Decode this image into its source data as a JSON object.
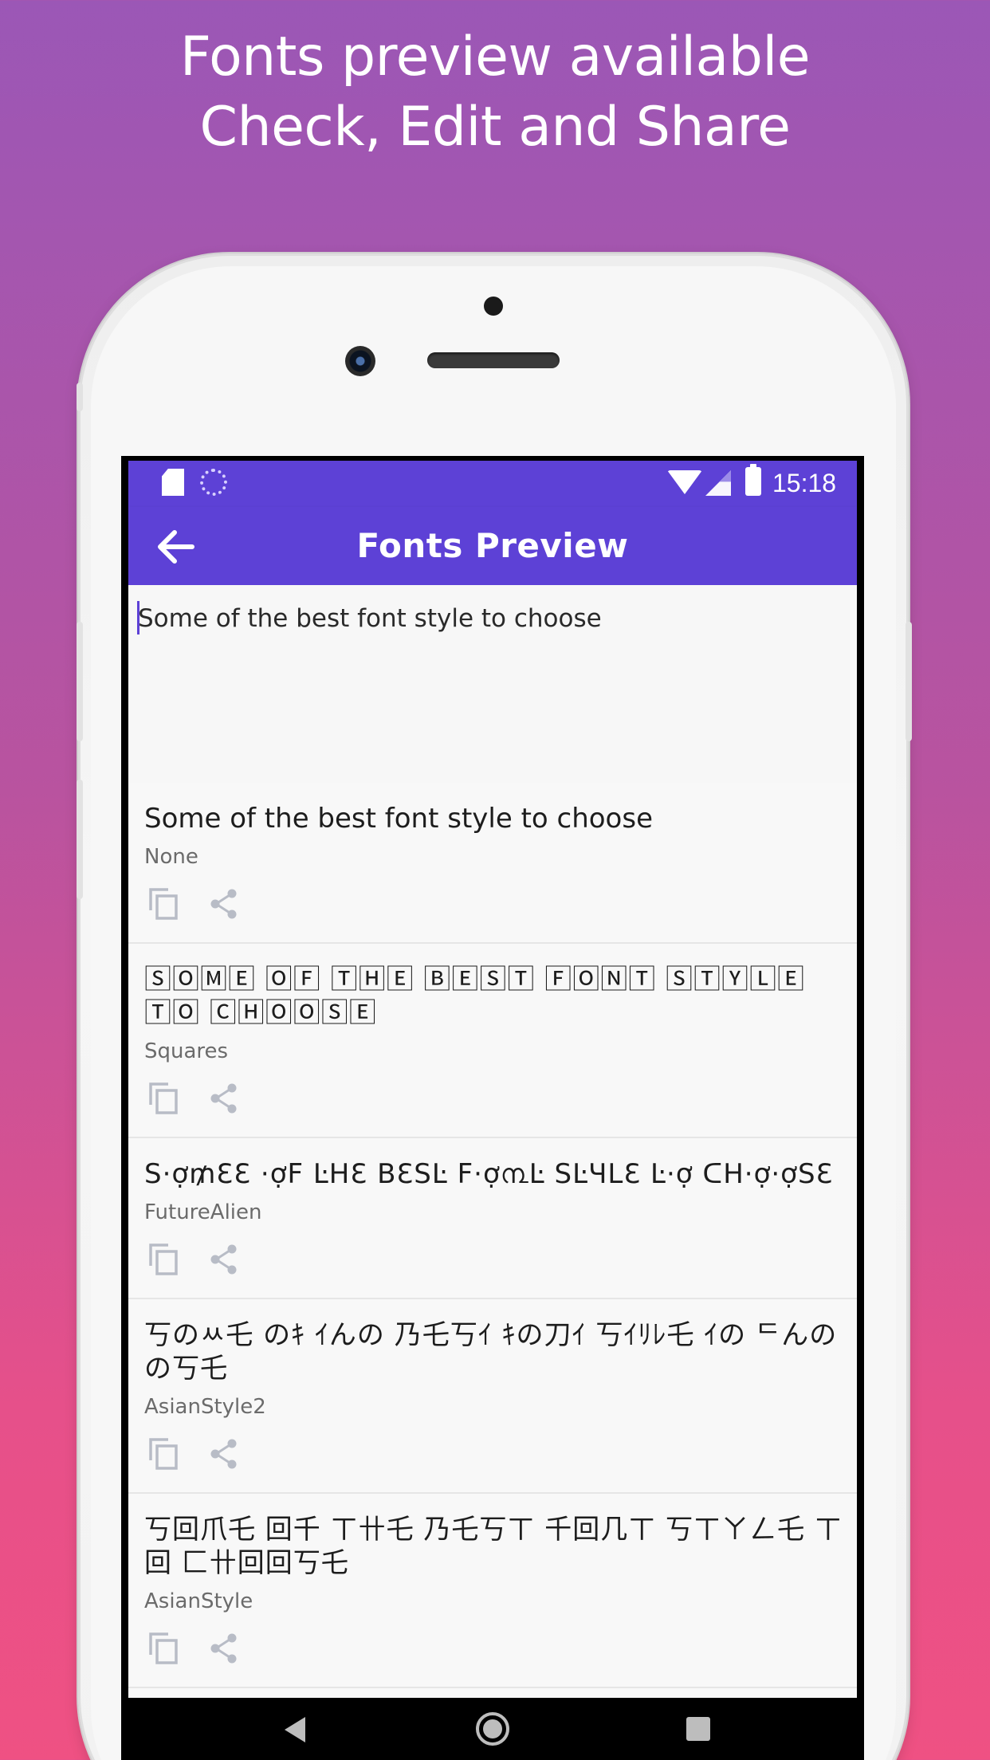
{
  "headline": {
    "line1": "Fonts preview available",
    "line2": "Check, Edit and Share"
  },
  "statusbar": {
    "time": "15:18",
    "icons": [
      "sd-card-icon",
      "sync-icon",
      "wifi-icon",
      "signal-icon",
      "battery-charging-icon"
    ]
  },
  "appbar": {
    "title": "Fonts Preview",
    "back_icon": "arrow-left-icon"
  },
  "editor": {
    "value": "Some of the best font style to choose"
  },
  "fonts": [
    {
      "text": "Some of the best font style to choose",
      "name": "None"
    },
    {
      "text": "🅂🄾🄼🄴 🄾🄵 🅃🄷🄴 🄱🄴🅂🅃 🄵🄾🄽🅃 🅂🅃🅈🄻🄴 🅃🄾 🄲🄷🄾🄾🅂🄴",
      "name": "Squares"
    },
    {
      "text": "S·ợ₥ƐƐ ·ợF ĿHƐ BƐSĿ F·ợ൩Ŀ SĿЧLƐ Ŀ·ợ ᑕH·ợ·ợSƐ",
      "name": "FutureAlien"
    },
    {
      "text": "丂のﾶ乇 のｷ ｲんの 乃乇丂ｲ ｷの刀ｲ 丂ｲﾘﾚ乇 ｲの ᄃんのの丂乇",
      "name": "AsianStyle2"
    },
    {
      "text": "丂回爪乇 回千 ㄒ卄乇 乃乇丂ㄒ 千回几ㄒ 丂ㄒㄚㄥ乇 ㄒ回 匚卄回回丂乇",
      "name": "AsianStyle"
    }
  ],
  "item_actions": {
    "copy_icon": "copy-icon",
    "share_icon": "share-icon"
  },
  "navbar": {
    "icons": [
      "nav-back-icon",
      "nav-home-icon",
      "nav-recents-icon"
    ]
  },
  "colors": {
    "accent": "#5d41d6",
    "background_top": "#9b57b6",
    "background_bottom": "#ef5183",
    "icon_gray": "#b8bcc6"
  }
}
